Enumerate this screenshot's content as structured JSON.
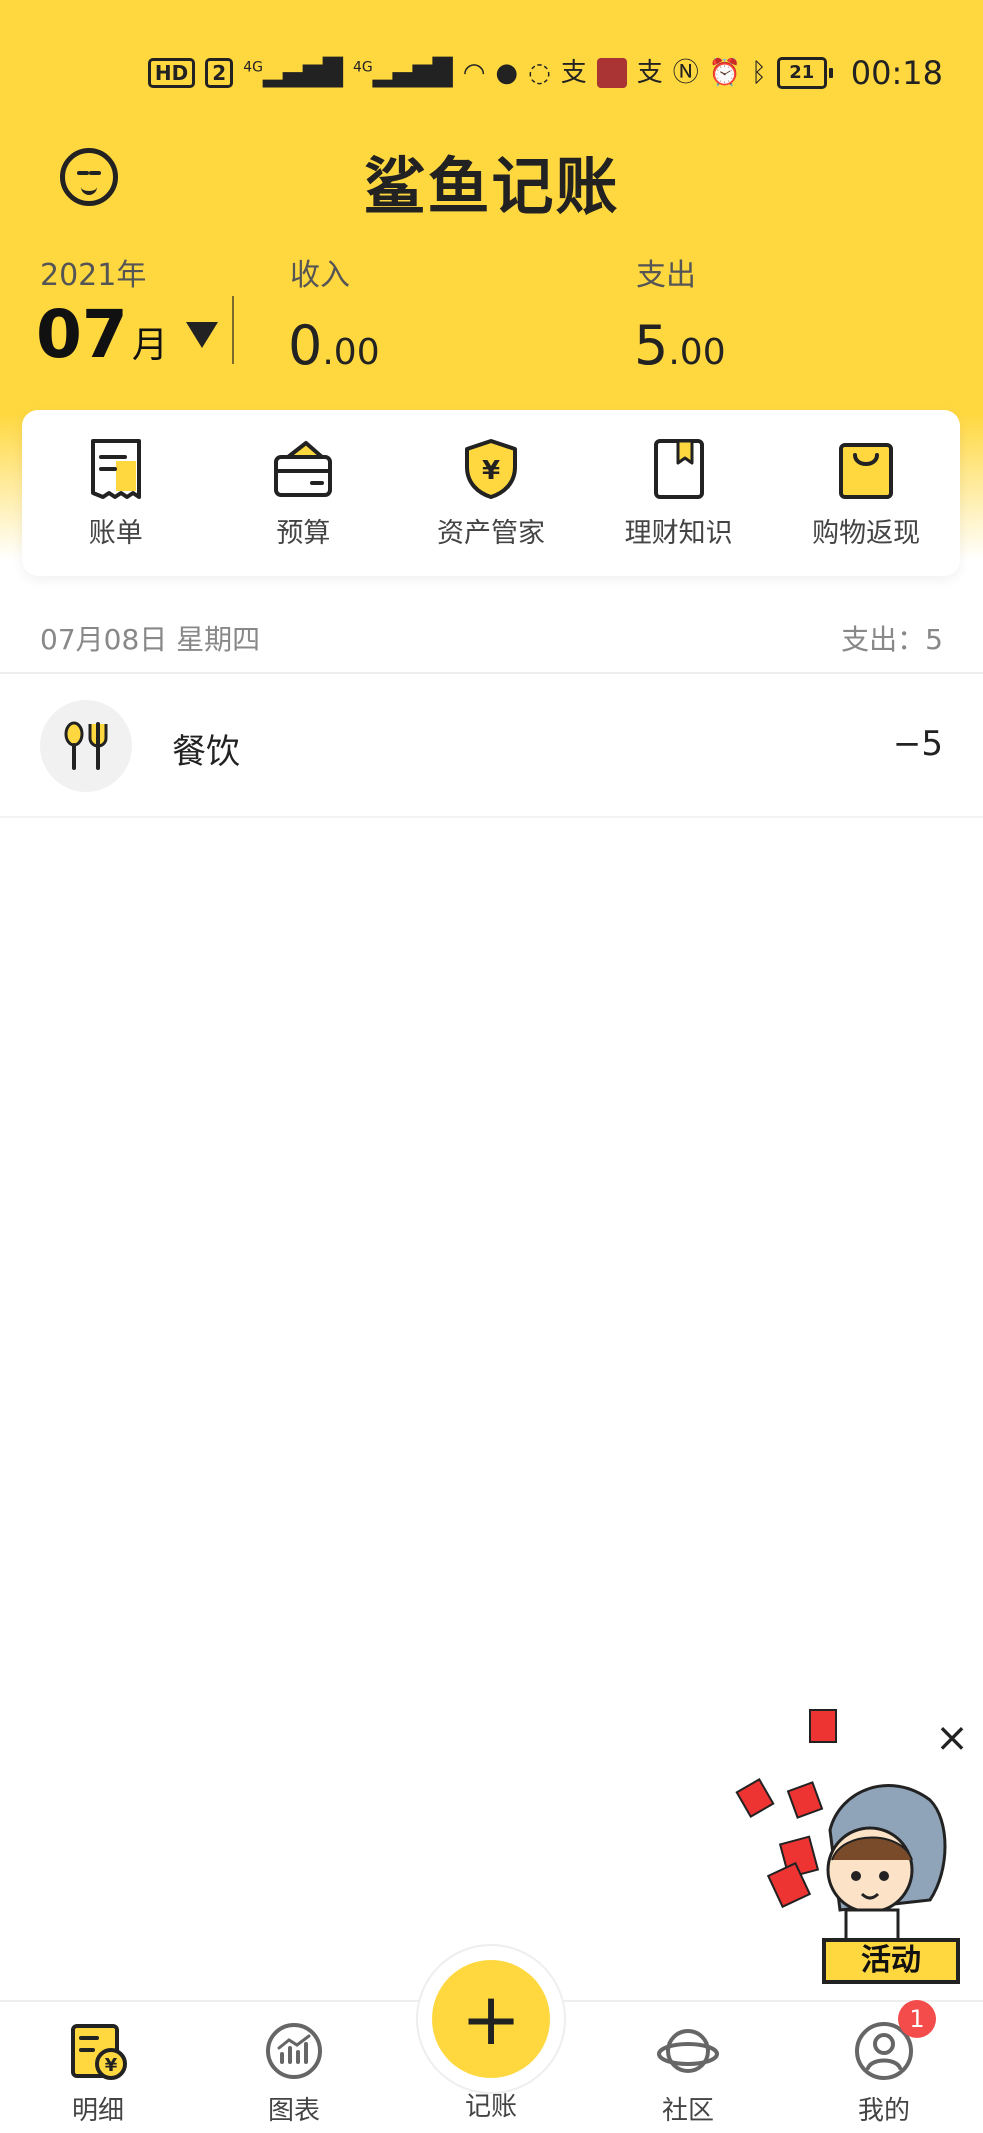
{
  "status_bar": {
    "hd": "HD",
    "sim": "2",
    "net1": "4G",
    "net2": "4G",
    "battery": "21",
    "time": "00:18"
  },
  "header": {
    "title": "鲨鱼记账",
    "year": "2021年",
    "month": "07",
    "month_unit": "月",
    "income_label": "收入",
    "income_int": "0",
    "income_dec": ".00",
    "expense_label": "支出",
    "expense_int": "5",
    "expense_dec": ".00"
  },
  "quick_actions": [
    {
      "label": "账单",
      "icon": "bill-icon"
    },
    {
      "label": "预算",
      "icon": "wallet-icon"
    },
    {
      "label": "资产管家",
      "icon": "asset-shield-icon"
    },
    {
      "label": "理财知识",
      "icon": "book-icon"
    },
    {
      "label": "购物返现",
      "icon": "shopping-bag-icon"
    }
  ],
  "day_group": {
    "date": "07月08日 星期四",
    "expense_summary": "支出：5"
  },
  "transactions": [
    {
      "category": "餐饮",
      "amount": "−5",
      "icon": "utensils-icon"
    }
  ],
  "promo": {
    "label": "活动"
  },
  "tab_bar": {
    "items": [
      {
        "label": "明细",
        "icon": "details-icon"
      },
      {
        "label": "图表",
        "icon": "chart-icon"
      },
      {
        "label": "记账",
        "icon": "plus-icon"
      },
      {
        "label": "社区",
        "icon": "planet-icon"
      },
      {
        "label": "我的",
        "icon": "profile-icon"
      }
    ],
    "badge_count": "1"
  },
  "colors": {
    "accent": "#FFD840",
    "badge": "#F44B4B"
  }
}
